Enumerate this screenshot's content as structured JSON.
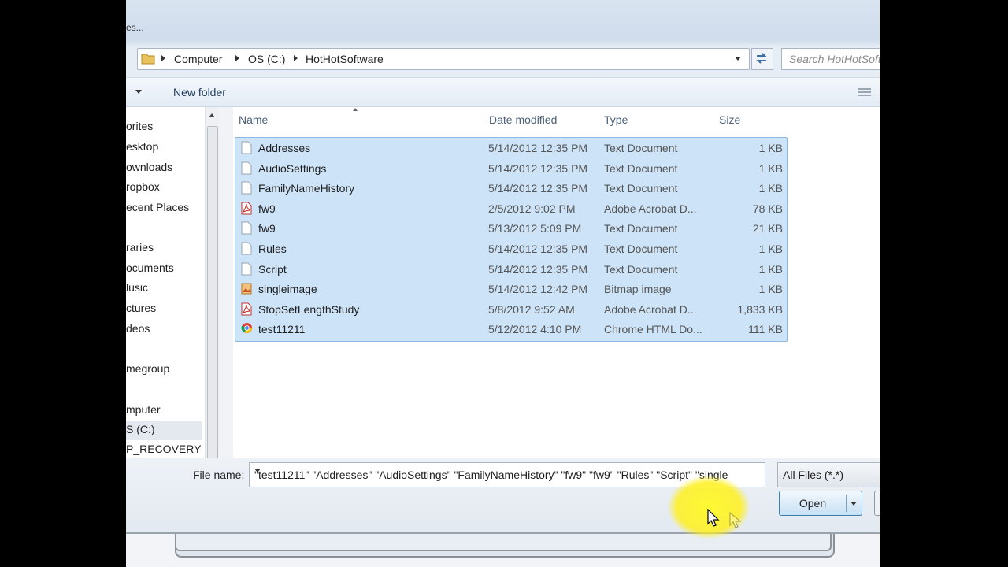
{
  "window": {
    "title_fragment": "es..."
  },
  "address_bar": {
    "crumbs": [
      "Computer",
      "OS (C:)",
      "HotHotSoftware"
    ],
    "search_placeholder": "Search HotHotSoftware"
  },
  "toolbar": {
    "new_folder_label": "New folder"
  },
  "navigation": [
    {
      "label": "orites"
    },
    {
      "label": "esktop"
    },
    {
      "label": "ownloads"
    },
    {
      "label": "ropbox"
    },
    {
      "label": "ecent Places"
    },
    {
      "label": "raries"
    },
    {
      "label": "ocuments"
    },
    {
      "label": "lusic"
    },
    {
      "label": "ctures"
    },
    {
      "label": "deos"
    },
    {
      "label": "megroup"
    },
    {
      "label": "mputer"
    },
    {
      "label": "S (C:)"
    },
    {
      "label": "P_RECOVERY (D"
    }
  ],
  "columns": {
    "name": "Name",
    "date": "Date modified",
    "type": "Type",
    "size": "Size"
  },
  "files": [
    {
      "name": "Addresses",
      "date": "5/14/2012 12:35 PM",
      "type": "Text Document",
      "size": "1 KB",
      "icon": "text-file-icon"
    },
    {
      "name": "AudioSettings",
      "date": "5/14/2012 12:35 PM",
      "type": "Text Document",
      "size": "1 KB",
      "icon": "text-file-icon"
    },
    {
      "name": "FamilyNameHistory",
      "date": "5/14/2012 12:35 PM",
      "type": "Text Document",
      "size": "1 KB",
      "icon": "text-file-icon"
    },
    {
      "name": "fw9",
      "date": "2/5/2012 9:02 PM",
      "type": "Adobe Acrobat D...",
      "size": "78 KB",
      "icon": "pdf-file-icon"
    },
    {
      "name": "fw9",
      "date": "5/13/2012 5:09 PM",
      "type": "Text Document",
      "size": "21 KB",
      "icon": "text-file-icon"
    },
    {
      "name": "Rules",
      "date": "5/14/2012 12:35 PM",
      "type": "Text Document",
      "size": "1 KB",
      "icon": "text-file-icon"
    },
    {
      "name": "Script",
      "date": "5/14/2012 12:35 PM",
      "type": "Text Document",
      "size": "1 KB",
      "icon": "text-file-icon"
    },
    {
      "name": "singleimage",
      "date": "5/14/2012 12:42 PM",
      "type": "Bitmap image",
      "size": "1 KB",
      "icon": "bitmap-file-icon"
    },
    {
      "name": "StopSetLengthStudy",
      "date": "5/8/2012 9:52 AM",
      "type": "Adobe Acrobat D...",
      "size": "1,833 KB",
      "icon": "pdf-file-icon"
    },
    {
      "name": "test11211",
      "date": "5/12/2012 4:10 PM",
      "type": "Chrome HTML Do...",
      "size": "111 KB",
      "icon": "chrome-file-icon"
    }
  ],
  "file_name": {
    "label": "File name:",
    "value": "\"test11211\" \"Addresses\" \"AudioSettings\" \"FamilyNameHistory\" \"fw9\" \"fw9\" \"Rules\" \"Script\" \"single"
  },
  "file_type": {
    "value": "All Files (*.*)"
  },
  "open_button": {
    "label": "Open"
  },
  "colors": {
    "selection_fill": "#cde3f7",
    "selection_border": "#8eb8e2",
    "highlight": "#fff028"
  }
}
